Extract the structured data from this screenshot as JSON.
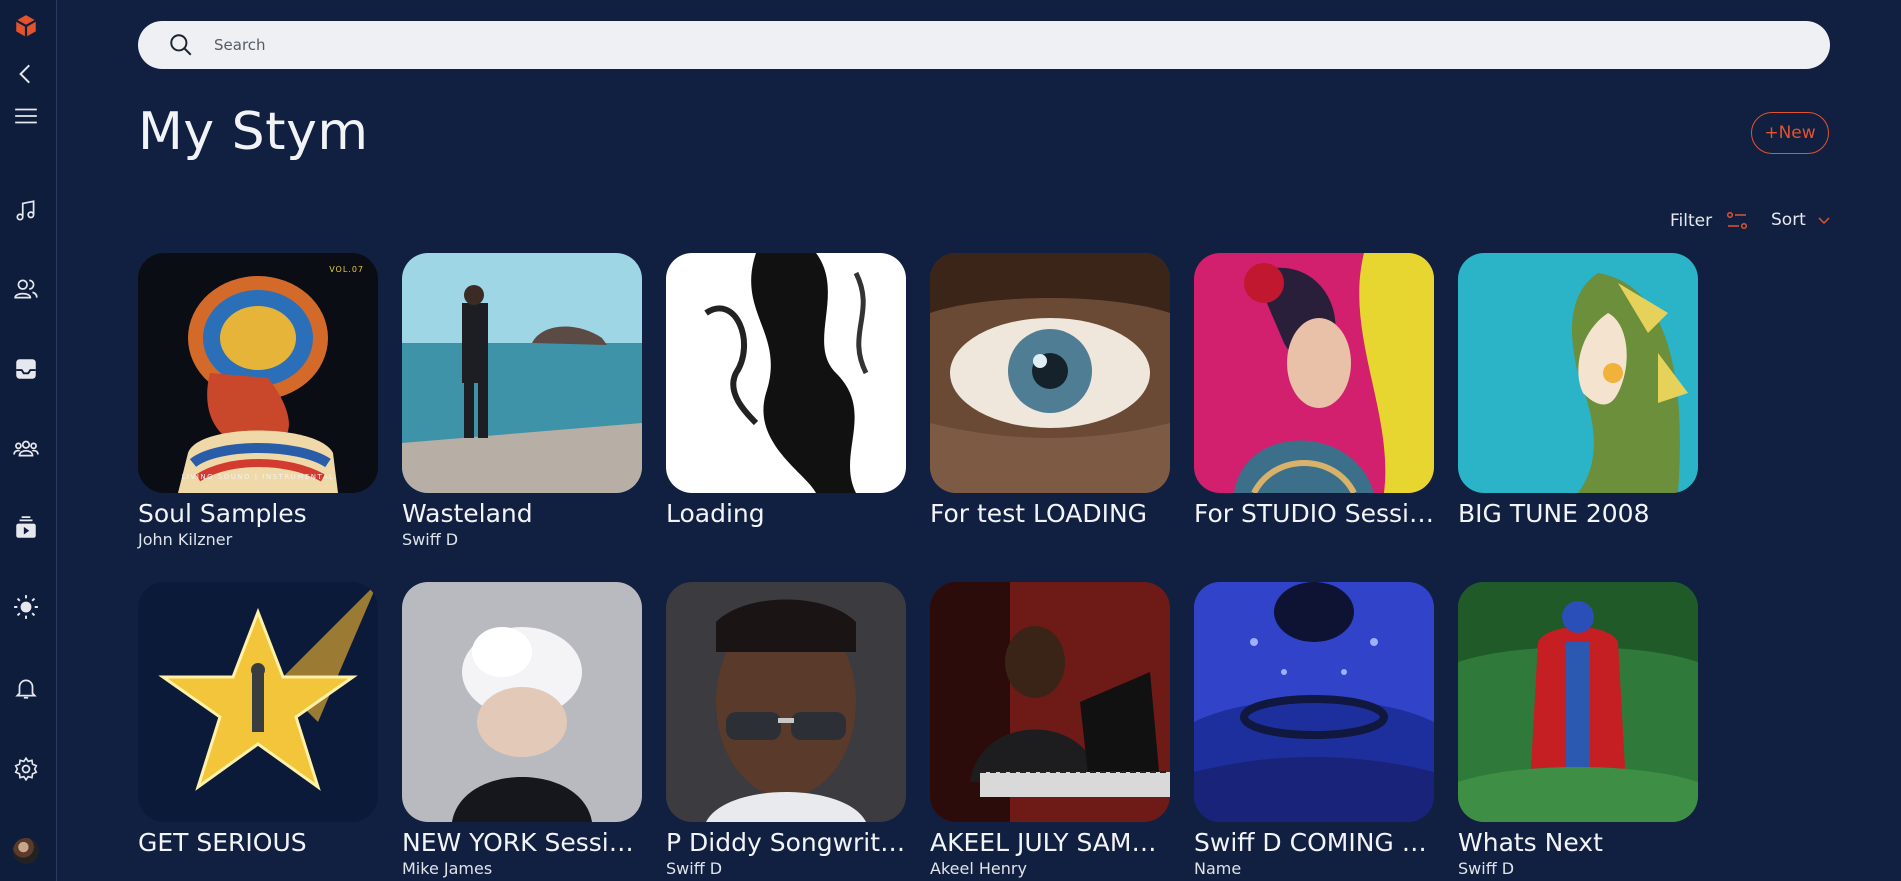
{
  "search": {
    "placeholder": "Search"
  },
  "page": {
    "title": "My Stym",
    "new_label": "+New"
  },
  "toolbar": {
    "filter_label": "Filter",
    "sort_label": "Sort"
  },
  "sidebar": {
    "icons": [
      "logo-icon",
      "back-icon",
      "menu-icon",
      "music-icon",
      "users-icon",
      "inbox-icon",
      "team-icon",
      "video-icon",
      "theme-icon",
      "notification-icon",
      "settings-icon"
    ]
  },
  "colors": {
    "background": "#111f40",
    "accent": "#e2532e",
    "search_bg": "#eef0f4"
  },
  "cards": [
    {
      "title": "Soul Samples",
      "subtitle": "John Kilzner",
      "cover_text": "VOL.07",
      "cover_caption": "LIVING SOUND | INSTRUMENTAL"
    },
    {
      "title": "Wasteland",
      "subtitle": "Swiff D"
    },
    {
      "title": "Loading",
      "subtitle": ""
    },
    {
      "title": "For test LOADING",
      "subtitle": ""
    },
    {
      "title": "For STUDIO Session",
      "subtitle": ""
    },
    {
      "title": "BIG TUNE 2008",
      "subtitle": ""
    },
    {
      "title": "GET SERIOUS",
      "subtitle": ""
    },
    {
      "title": "NEW YORK Sessio...",
      "subtitle": "Mike James"
    },
    {
      "title": "P Diddy Songwriti...",
      "subtitle": "Swiff D"
    },
    {
      "title": "AKEEL JULY SAMPL...",
      "subtitle": "Akeel Henry"
    },
    {
      "title": "Swiff D COMING H...",
      "subtitle": "Name"
    },
    {
      "title": "Whats Next",
      "subtitle": "Swiff D"
    }
  ]
}
